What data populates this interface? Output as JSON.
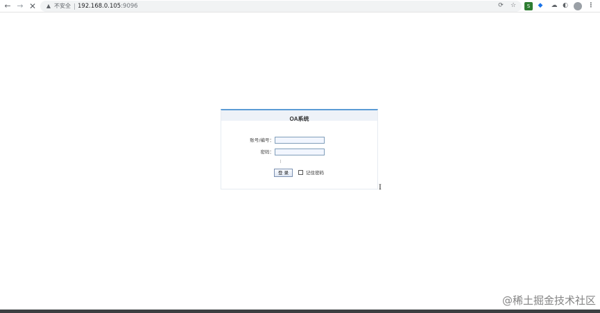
{
  "browser": {
    "nav": {
      "back_icon": "←",
      "forward_icon": "→",
      "stop_icon": "✕"
    },
    "address_bar": {
      "security_label": "不安全",
      "url_host": "192.168.0.105",
      "url_port": ":9096"
    },
    "toolbar_icons": {
      "ext1": "⟳",
      "ext2": "☆",
      "ext3": "S",
      "ext4": "◆",
      "ext5": "☁",
      "ext6": "◐",
      "ext8": "⋮"
    }
  },
  "login": {
    "title": "OA系统",
    "account_label": "账号/编号：",
    "password_label": "密码：",
    "account_value": "",
    "password_value": "",
    "login_button": "登 录",
    "remember_label": "记住密码",
    "remember_checked": false
  },
  "watermark": "@稀土掘金技术社区",
  "colors": {
    "accent": "#5b9bd5",
    "header_bg": "#eef2f8",
    "input_bg": "#f2f6ff",
    "input_border": "#7f9db9"
  }
}
